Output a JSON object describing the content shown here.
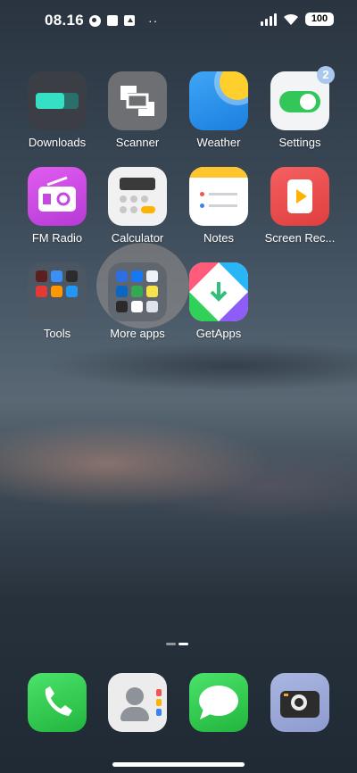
{
  "status_bar": {
    "time": "08.16",
    "dots": "··",
    "battery": "100"
  },
  "apps": [
    {
      "label": "Downloads",
      "icon": "downloads-icon"
    },
    {
      "label": "Scanner",
      "icon": "scanner-icon"
    },
    {
      "label": "Weather",
      "icon": "weather-icon"
    },
    {
      "label": "Settings",
      "icon": "settings-icon",
      "badge": "2"
    },
    {
      "label": "FM Radio",
      "icon": "fm-radio-icon"
    },
    {
      "label": "Calculator",
      "icon": "calculator-icon"
    },
    {
      "label": "Notes",
      "icon": "notes-icon"
    },
    {
      "label": "Screen Rec...",
      "icon": "screen-recorder-icon"
    },
    {
      "label": "Tools",
      "icon": "tools-folder-icon"
    },
    {
      "label": "More apps",
      "icon": "more-apps-folder-icon"
    },
    {
      "label": "GetApps",
      "icon": "getapps-icon"
    }
  ],
  "dock": [
    {
      "icon": "phone-icon"
    },
    {
      "icon": "contacts-icon"
    },
    {
      "icon": "messages-icon"
    },
    {
      "icon": "camera-icon"
    }
  ],
  "colors": {
    "settings_green": "#33c759",
    "weather_blue": "#2196f3",
    "fm_purple": "#d44be8",
    "recorder_red": "#ef4f4f",
    "phone_green": "#38d353",
    "badge": "#a9c8ee"
  }
}
